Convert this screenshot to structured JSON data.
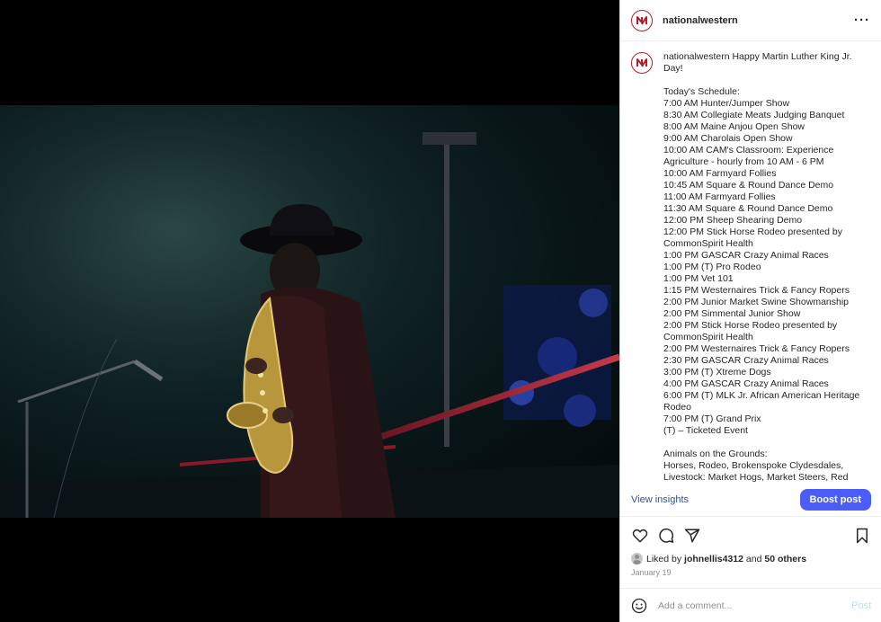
{
  "post": {
    "username": "nationalwestern",
    "more_icon": "more-horizontal-icon",
    "caption_username": "nationalwestern",
    "caption_body": " Happy Martin Luther King Jr. Day!\n\nToday's Schedule:\n7:00 AM Hunter/Jumper Show\n8:30 AM Collegiate Meats Judging Banquet\n8:00 AM Maine Anjou Open Show\n9:00 AM Charolais Open Show\n10:00 AM CAM's Classroom: Experience Agriculture - hourly from 10 AM - 6 PM\n10:00 AM Farmyard Follies\n10:45 AM Square & Round Dance Demo\n11:00 AM Farmyard Follies\n11:30 AM Square & Round Dance Demo\n12:00 PM Sheep Shearing Demo\n12:00 PM Stick Horse Rodeo presented by CommonSpirit Health\n1:00 PM GASCAR Crazy Animal Races\n1:00 PM (T) Pro Rodeo\n1:00 PM Vet 101\n1:15 PM Westernaires Trick & Fancy Ropers\n2:00 PM Junior Market Swine Showmanship\n2:00 PM Simmental Junior Show\n2:00 PM Stick Horse Rodeo presented by CommonSpirit Health\n2:00 PM Westernaires Trick & Fancy Ropers\n2:30 PM GASCAR Crazy Animal Races\n3:00 PM (T) Xtreme Dogs\n4:00 PM GASCAR Crazy Animal Races\n6:00 PM (T) MLK Jr. African American Heritage Rodeo\n7:00 PM (T) Grand Prix\n(T) – Ticketed Event\n\nAnimals on the Grounds:\nHorses, Rodeo, Brokenspoke Clydesdales, Livestock: Market Hogs, Market Steers, Red"
  },
  "insights": {
    "view_label": "View insights",
    "boost_label": "Boost post"
  },
  "actions": {
    "like_icon": "heart-icon",
    "comment_icon": "comment-icon",
    "share_icon": "send-icon",
    "save_icon": "bookmark-icon"
  },
  "likes": {
    "prefix": "Liked by ",
    "user": "johnellis4312",
    "middle": " and ",
    "others": "50 others"
  },
  "date": "January 19",
  "comment": {
    "placeholder": "Add a comment...",
    "post_label": "Post"
  },
  "colors": {
    "accent": "#4a5df9",
    "brand": "#b01e2e",
    "link": "#385185"
  }
}
